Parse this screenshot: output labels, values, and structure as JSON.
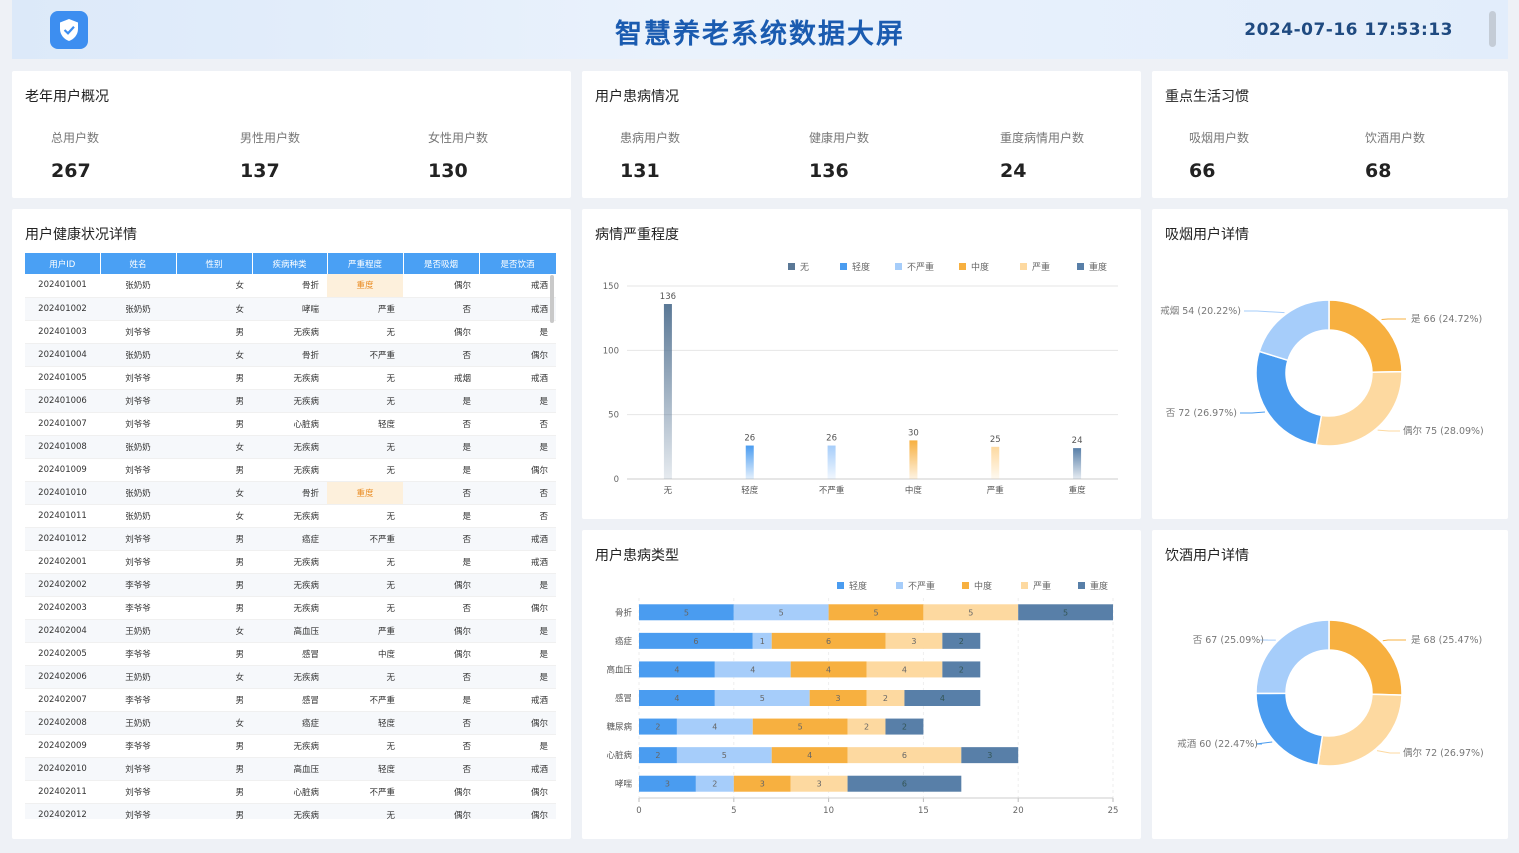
{
  "header": {
    "title": "智慧养老系统数据大屏",
    "time": "2024-07-16 17:53:13"
  },
  "elderly": {
    "title": "老年用户概况",
    "stats": [
      {
        "label": "总用户数",
        "value": "267"
      },
      {
        "label": "男性用户数",
        "value": "137"
      },
      {
        "label": "女性用户数",
        "value": "130"
      }
    ]
  },
  "disease": {
    "title": "用户患病情况",
    "stats": [
      {
        "label": "患病用户数",
        "value": "131"
      },
      {
        "label": "健康用户数",
        "value": "136"
      },
      {
        "label": "重度病情用户数",
        "value": "24"
      }
    ]
  },
  "habits": {
    "title": "重点生活习惯",
    "stats": [
      {
        "label": "吸烟用户数",
        "value": "66"
      },
      {
        "label": "饮酒用户数",
        "value": "68"
      }
    ]
  },
  "table": {
    "title": "用户健康状况详情",
    "headers": [
      "用户ID",
      "姓名",
      "性别",
      "疾病种类",
      "严重程度",
      "是否吸烟",
      "是否饮酒"
    ],
    "rows": [
      [
        "202401001",
        "张奶奶",
        "女",
        "骨折",
        "重度",
        "偶尔",
        "戒酒"
      ],
      [
        "202401002",
        "张奶奶",
        "女",
        "哮喘",
        "严重",
        "否",
        "戒酒"
      ],
      [
        "202401003",
        "刘爷爷",
        "男",
        "无疾病",
        "无",
        "偶尔",
        "是"
      ],
      [
        "202401004",
        "张奶奶",
        "女",
        "骨折",
        "不严重",
        "否",
        "偶尔"
      ],
      [
        "202401005",
        "刘爷爷",
        "男",
        "无疾病",
        "无",
        "戒烟",
        "戒酒"
      ],
      [
        "202401006",
        "刘爷爷",
        "男",
        "无疾病",
        "无",
        "是",
        "是"
      ],
      [
        "202401007",
        "刘爷爷",
        "男",
        "心脏病",
        "轻度",
        "否",
        "否"
      ],
      [
        "202401008",
        "张奶奶",
        "女",
        "无疾病",
        "无",
        "是",
        "是"
      ],
      [
        "202401009",
        "刘爷爷",
        "男",
        "无疾病",
        "无",
        "是",
        "偶尔"
      ],
      [
        "202401010",
        "张奶奶",
        "女",
        "骨折",
        "重度",
        "否",
        "否"
      ],
      [
        "202401011",
        "张奶奶",
        "女",
        "无疾病",
        "无",
        "是",
        "否"
      ],
      [
        "202401012",
        "刘爷爷",
        "男",
        "癌症",
        "不严重",
        "否",
        "戒酒"
      ],
      [
        "202402001",
        "刘爷爷",
        "男",
        "无疾病",
        "无",
        "是",
        "戒酒"
      ],
      [
        "202402002",
        "李爷爷",
        "男",
        "无疾病",
        "无",
        "偶尔",
        "是"
      ],
      [
        "202402003",
        "李爷爷",
        "男",
        "无疾病",
        "无",
        "否",
        "偶尔"
      ],
      [
        "202402004",
        "王奶奶",
        "女",
        "高血压",
        "严重",
        "偶尔",
        "是"
      ],
      [
        "202402005",
        "李爷爷",
        "男",
        "感冒",
        "中度",
        "偶尔",
        "是"
      ],
      [
        "202402006",
        "王奶奶",
        "女",
        "无疾病",
        "无",
        "否",
        "是"
      ],
      [
        "202402007",
        "李爷爷",
        "男",
        "感冒",
        "不严重",
        "是",
        "戒酒"
      ],
      [
        "202402008",
        "王奶奶",
        "女",
        "癌症",
        "轻度",
        "否",
        "偶尔"
      ],
      [
        "202402009",
        "李爷爷",
        "男",
        "无疾病",
        "无",
        "否",
        "是"
      ],
      [
        "202402010",
        "刘爷爷",
        "男",
        "高血压",
        "轻度",
        "否",
        "戒酒"
      ],
      [
        "202402011",
        "刘爷爷",
        "男",
        "心脏病",
        "不严重",
        "偶尔",
        "偶尔"
      ],
      [
        "202402012",
        "刘爷爷",
        "男",
        "无疾病",
        "无",
        "偶尔",
        "偶尔"
      ]
    ]
  },
  "colors": {
    "none": "#5a7896",
    "mild": "#4a9cf0",
    "notsevere": "#a6cdfa",
    "moderate": "#f7b040",
    "severe": "#fdd9a0",
    "grave": "#587fa8"
  },
  "chart_data": [
    {
      "type": "bar",
      "title": "病情严重程度",
      "categories": [
        "无",
        "轻度",
        "不严重",
        "中度",
        "严重",
        "重度"
      ],
      "values": [
        136,
        26,
        26,
        30,
        25,
        24
      ],
      "legend": [
        "无",
        "轻度",
        "不严重",
        "中度",
        "严重",
        "重度"
      ],
      "legend_position": "top-right",
      "ylim": [
        0,
        150
      ],
      "yticks": [
        0,
        50,
        100,
        150
      ],
      "grid": true
    },
    {
      "type": "bar",
      "orientation": "horizontal",
      "stacked": true,
      "title": "用户患病类型",
      "categories": [
        "骨折",
        "癌症",
        "高血压",
        "感冒",
        "糖尿病",
        "心脏病",
        "哮喘"
      ],
      "series": [
        {
          "name": "轻度",
          "values": [
            5,
            6,
            4,
            4,
            2,
            2,
            3
          ]
        },
        {
          "name": "不严重",
          "values": [
            5,
            1,
            4,
            5,
            4,
            5,
            2
          ]
        },
        {
          "name": "中度",
          "values": [
            5,
            6,
            4,
            3,
            5,
            4,
            3
          ]
        },
        {
          "name": "严重",
          "values": [
            5,
            3,
            4,
            2,
            2,
            6,
            3
          ]
        },
        {
          "name": "重度",
          "values": [
            5,
            2,
            2,
            4,
            2,
            3,
            6
          ]
        }
      ],
      "legend_position": "top-right",
      "xlim": [
        0,
        25
      ],
      "xticks": [
        0,
        5,
        10,
        15,
        20,
        25
      ],
      "grid": true
    },
    {
      "type": "pie",
      "variant": "donut",
      "title": "吸烟用户详情",
      "slices": [
        {
          "name": "是",
          "value": 66,
          "label": "是 66 (24.72%)"
        },
        {
          "name": "偶尔",
          "value": 75,
          "label": "偶尔 75 (28.09%)"
        },
        {
          "name": "否",
          "value": 72,
          "label": "否 72 (26.97%)"
        },
        {
          "name": "戒烟",
          "value": 54,
          "label": "戒烟 54 (20.22%)"
        }
      ]
    },
    {
      "type": "pie",
      "variant": "donut",
      "title": "饮酒用户详情",
      "slices": [
        {
          "name": "是",
          "value": 68,
          "label": "是 68 (25.47%)"
        },
        {
          "name": "偶尔",
          "value": 72,
          "label": "偶尔 72 (26.97%)"
        },
        {
          "name": "戒酒",
          "value": 60,
          "label": "戒酒 60 (22.47%)"
        },
        {
          "name": "否",
          "value": 67,
          "label": "否 67 (25.09%)"
        }
      ]
    }
  ]
}
